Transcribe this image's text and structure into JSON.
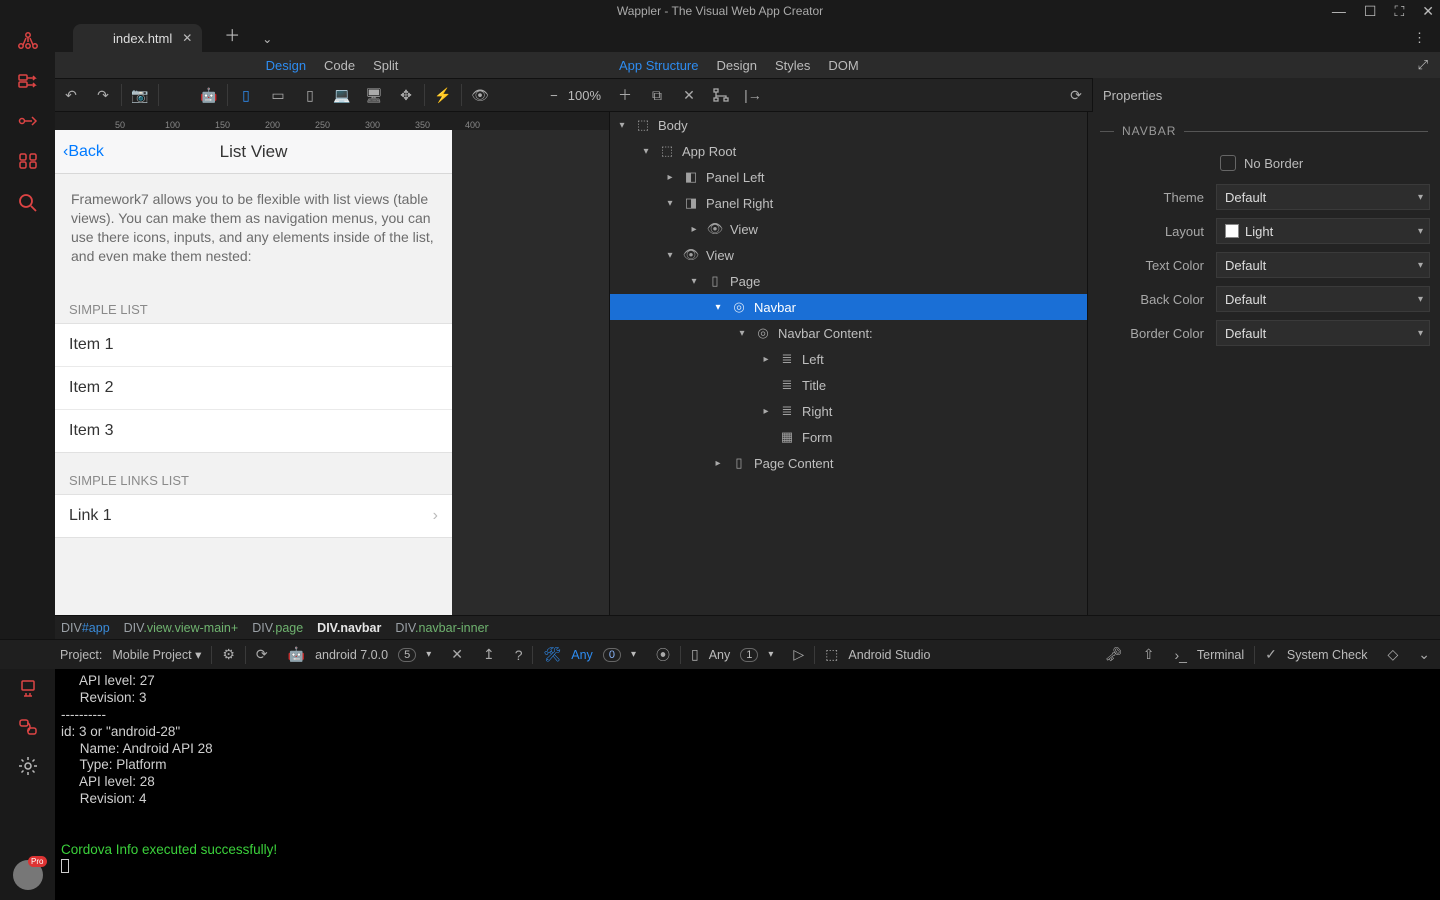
{
  "titlebar": {
    "title": "Wappler - The Visual Web App Creator"
  },
  "tabs": {
    "file": "index.html"
  },
  "modes_left": {
    "design": "Design",
    "code": "Code",
    "split": "Split"
  },
  "modes_right": {
    "app_structure": "App Structure",
    "design": "Design",
    "styles": "Styles",
    "dom": "DOM"
  },
  "toolbar": {
    "zoom_value": "100%"
  },
  "ruler": {
    "marks": [
      "50",
      "100",
      "150",
      "200",
      "250",
      "300",
      "350",
      "400"
    ]
  },
  "canvas": {
    "dim_label": "360px x 487px",
    "back_label": "Back",
    "page_title": "List View",
    "intro_text": "Framework7 allows you to be flexible with list views (table views). You can make them as navigation menus, you can use there icons, inputs, and any elements inside of the list, and even make them nested:",
    "section_simple": "SIMPLE LIST",
    "items": [
      "Item 1",
      "Item 2",
      "Item 3"
    ],
    "section_links": "SIMPLE LINKS LIST",
    "links": [
      "Link 1"
    ]
  },
  "tree": {
    "body": "Body",
    "app_root": "App Root",
    "panel_left": "Panel Left",
    "panel_right": "Panel Right",
    "view_a": "View",
    "view_b": "View",
    "page": "Page",
    "navbar": "Navbar",
    "navbar_content": "Navbar Content:",
    "left": "Left",
    "title": "Title",
    "right": "Right",
    "form": "Form",
    "page_content": "Page Content"
  },
  "props": {
    "panel_title": "Properties",
    "section": "NAVBAR",
    "no_border": "No Border",
    "theme_label": "Theme",
    "theme_value": "Default",
    "layout_label": "Layout",
    "layout_value": "Light",
    "text_color_label": "Text Color",
    "text_color_value": "Default",
    "back_color_label": "Back Color",
    "back_color_value": "Default",
    "border_color_label": "Border Color",
    "border_color_value": "Default"
  },
  "crumbs": {
    "c1_tag": "DIV",
    "c1_id": "#app",
    "c2_tag": "DIV",
    "c2_cls": ".view.view-main+",
    "c3_tag": "DIV",
    "c3_cls": ".page",
    "c4_tag": "DIV",
    "c4_cls": ".navbar",
    "c5_tag": "DIV",
    "c5_cls": ".navbar-inner"
  },
  "status": {
    "project_label": "Project:",
    "project_name": "Mobile Project",
    "platform": "android 7.0.0",
    "platform_count": "5",
    "any_label": "Any",
    "any_count": "0",
    "device_any": "Any",
    "device_count": "1",
    "studio": "Android Studio",
    "terminal": "Terminal",
    "system_check": "System Check"
  },
  "terminal": {
    "l1": "     API level: 27",
    "l2": "     Revision: 3",
    "l3": "----------",
    "l4": "id: 3 or \"android-28\"",
    "l5": "     Name: Android API 28",
    "l6": "     Type: Platform",
    "l7": "     API level: 28",
    "l8": "     Revision: 4",
    "l9": "",
    "l10": "",
    "ok": "Cordova Info executed successfully!",
    "avatar_badge": "Pro"
  }
}
